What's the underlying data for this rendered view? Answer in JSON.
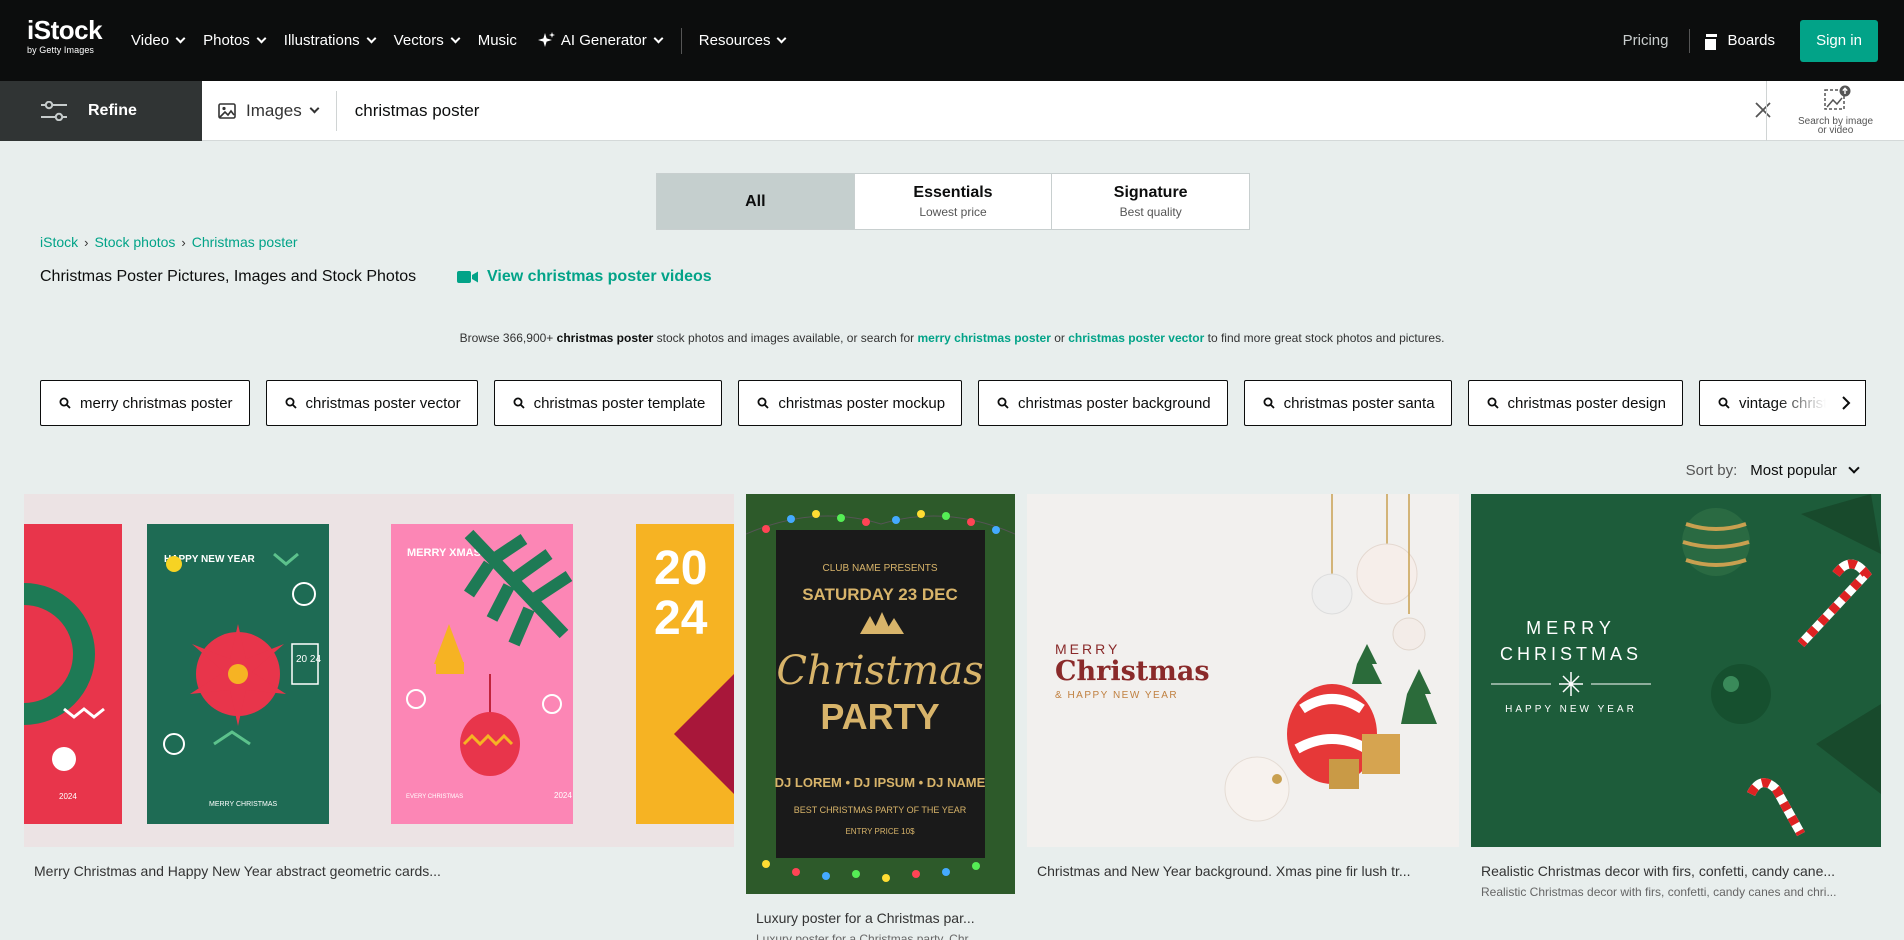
{
  "header": {
    "logo_main": "iStock",
    "logo_sub": "by Getty Images",
    "nav": [
      {
        "label": "Video",
        "chevron": true
      },
      {
        "label": "Photos",
        "chevron": true
      },
      {
        "label": "Illustrations",
        "chevron": true
      },
      {
        "label": "Vectors",
        "chevron": true
      },
      {
        "label": "Music",
        "chevron": false
      },
      {
        "label": "AI Generator",
        "chevron": true
      },
      {
        "label": "Resources",
        "chevron": true
      }
    ],
    "pricing": "Pricing",
    "boards": "Boards",
    "signin": "Sign in",
    "accent": "#02a388"
  },
  "search": {
    "refine_label": "Refine",
    "type_label": "Images",
    "query": "christmas poster",
    "by_image_label_1": "Search by image",
    "by_image_label_2": "or video"
  },
  "tabs": [
    {
      "title": "All",
      "subtitle": "",
      "active": true
    },
    {
      "title": "Essentials",
      "subtitle": "Lowest price",
      "active": false
    },
    {
      "title": "Signature",
      "subtitle": "Best quality",
      "active": false
    }
  ],
  "breadcrumb": [
    "iStock",
    "Stock photos",
    "Christmas poster"
  ],
  "page_title": "Christmas Poster Pictures, Images and Stock Photos",
  "video_link": "View christmas poster videos",
  "browse": {
    "prefix": "Browse 366,900+ ",
    "term": "christmas poster",
    "middle": " stock photos and images available, or search for ",
    "link1": "merry christmas poster",
    "or": " or ",
    "link2": "christmas poster vector",
    "suffix": " to find more great stock photos and pictures."
  },
  "chips": [
    "merry christmas poster",
    "christmas poster vector",
    "christmas poster template",
    "christmas poster mockup",
    "christmas poster background",
    "christmas poster santa",
    "christmas poster design",
    "vintage christmas poster"
  ],
  "sort": {
    "label": "Sort by:",
    "value": "Most popular"
  },
  "results": [
    {
      "caption": "Merry Christmas and Happy New Year abstract geometric cards...",
      "subcaption": ""
    },
    {
      "caption": "Luxury poster for a Christmas par...",
      "subcaption": "Luxury poster for a Christmas party. Chr..."
    },
    {
      "caption": "Christmas and New Year background. Xmas pine fir lush tr...",
      "subcaption": ""
    },
    {
      "caption": "Realistic Christmas decor with firs, confetti, candy cane...",
      "subcaption": "Realistic Christmas decor with firs, confetti, candy canes and chri..."
    }
  ],
  "image_text": {
    "card1": {
      "merry_xmas": "MERRY XMAS",
      "happy_new_year": "HAPPY NEW YEAR",
      "year": "2024",
      "short_year": "20 24",
      "merry_christmas": "MERRY CHRISTMAS",
      "every_christmas": "EVERY CHRISTMAS"
    },
    "card2": {
      "club": "CLUB NAME PRESENTS",
      "date": "SATURDAY 23 DEC",
      "christmas": "Christmas",
      "party": "PARTY",
      "djs": "DJ LOREM • DJ IPSUM • DJ NAME",
      "best": "BEST CHRISTMAS PARTY OF THE YEAR",
      "entry": "ENTRY PRICE 10$"
    },
    "card3": {
      "merry": "MERRY",
      "christmas": "Christmas",
      "happy": "& HAPPY NEW YEAR"
    },
    "card4": {
      "merry": "MERRY",
      "christmas": "CHRISTMAS",
      "happy": "HAPPY   NEW   YEAR"
    }
  }
}
